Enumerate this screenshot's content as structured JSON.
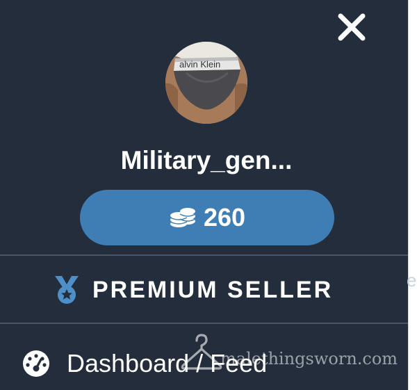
{
  "profile": {
    "username": "Military_gen...",
    "avatar_caption": "alvin Klein",
    "coins": "260"
  },
  "menu": {
    "premium_label": "PREMIUM SELLER",
    "dashboard_label": "Dashboard / Feed"
  },
  "watermark": {
    "text": "malethingsworn.com"
  },
  "icons": {
    "close": "close-icon",
    "coins": "coins-stack-icon",
    "premium": "medal-icon",
    "dashboard": "speedometer-icon",
    "watermark": "hanger-icon"
  },
  "colors": {
    "panel_bg": "#232d3b",
    "accent": "#3f7eb5",
    "text": "#ffffff",
    "divider": "#4b5564"
  }
}
